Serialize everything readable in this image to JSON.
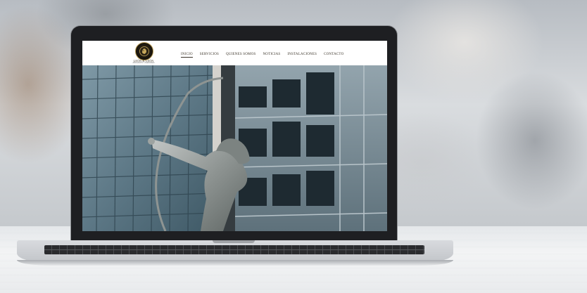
{
  "site": {
    "logo_name": "LEÓN & LEÓN",
    "logo_tagline": "ABOGADOS Y ASESORES"
  },
  "nav": {
    "items": [
      {
        "label": "INICIO",
        "active": true
      },
      {
        "label": "SERVICIOS"
      },
      {
        "label": "QUIENES SOMOS"
      },
      {
        "label": "NOTICIAS"
      },
      {
        "label": "INSTALACIONES"
      },
      {
        "label": "CONTACTO"
      }
    ]
  },
  "hero": {
    "image": "archer-statue-glass-buildings"
  },
  "colors": {
    "accent_gold": "#b79a52",
    "nav_text": "#3a3328"
  }
}
